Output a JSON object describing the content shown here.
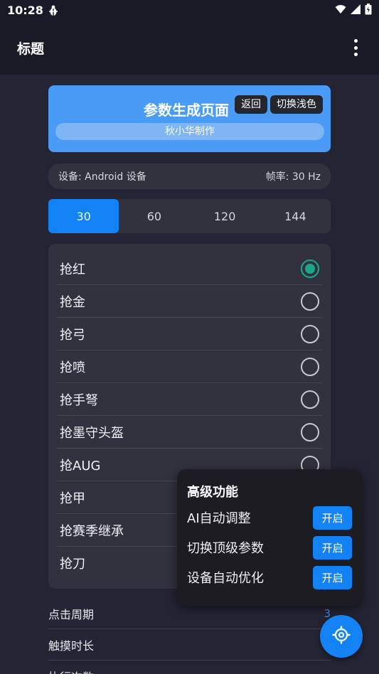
{
  "status_bar": {
    "time": "10:28"
  },
  "app_bar": {
    "title": "标题"
  },
  "header": {
    "title": "参数生成页面",
    "back_label": "返回",
    "theme_label": "切换浅色",
    "credit": "秋小华制作"
  },
  "info": {
    "device": "设备: Android 设备",
    "fps": "帧率: 30 Hz"
  },
  "fps_options": [
    "30",
    "60",
    "120",
    "144"
  ],
  "fps_selected": "30",
  "options": [
    {
      "label": "抢红",
      "checked": true
    },
    {
      "label": "抢金",
      "checked": false
    },
    {
      "label": "抢弓",
      "checked": false
    },
    {
      "label": "抢喷",
      "checked": false
    },
    {
      "label": "抢手弩",
      "checked": false
    },
    {
      "label": "抢墨守头盔",
      "checked": false
    },
    {
      "label": "抢AUG",
      "checked": false
    },
    {
      "label": "抢甲",
      "checked": false
    },
    {
      "label": "抢赛季继承",
      "checked": false
    },
    {
      "label": "抢刀",
      "checked": false
    }
  ],
  "params": [
    {
      "label": "点击周期",
      "value": "3"
    },
    {
      "label": "触摸时长",
      "value": ""
    },
    {
      "label": "执行次数",
      "value": ""
    }
  ],
  "advanced": {
    "title": "高级功能",
    "items": [
      {
        "label": "AI自动调整",
        "button": "开启"
      },
      {
        "label": "切换顶级参数",
        "button": "开启"
      },
      {
        "label": "设备自动优化",
        "button": "开启"
      }
    ]
  },
  "colors": {
    "accent": "#1282f5",
    "header": "#4a9bf5",
    "radio_checked": "#18a888"
  },
  "icons": {
    "fab": "gear-icon",
    "menu": "more-vert-icon"
  }
}
